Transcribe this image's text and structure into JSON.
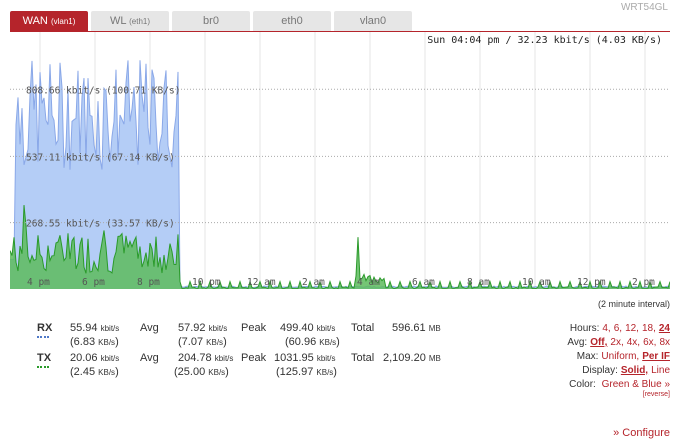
{
  "device_name": "WRT54GL",
  "tabs": [
    {
      "label": "WAN",
      "sub": "(vlan1)",
      "active": true
    },
    {
      "label": "WL",
      "sub": "(eth1)",
      "active": false
    },
    {
      "label": "br0",
      "sub": "",
      "active": false
    },
    {
      "label": "eth0",
      "sub": "",
      "active": false
    },
    {
      "label": "vlan0",
      "sub": "",
      "active": false
    }
  ],
  "graph": {
    "status": "Sun 04:04 pm / 32.23 kbit/s (4.03 KB/s)",
    "gridlines": [
      {
        "label": "808.66 kbit/s (100.71 KB/s)",
        "value": 808.66
      },
      {
        "label": "537.11 kbit/s (67.14 KB/s)",
        "value": 537.11
      },
      {
        "label": "268.55 kbit/s (33.57 KB/s)",
        "value": 268.55
      }
    ],
    "time_labels": [
      "4 pm",
      "6 pm",
      "8 pm",
      "10 pm",
      "12 am",
      "2 am",
      "4 am",
      "6 am",
      "8 am",
      "10 am",
      "12 pm",
      "2 pm"
    ],
    "colors": {
      "rx": "#8aa8e8",
      "rx_fill": "#b4cdf6",
      "tx": "#2a9a2a",
      "tx_fill": "#5dbb5d",
      "grid": "#cccccc"
    }
  },
  "interval_note": "(2 minute interval)",
  "stats": {
    "rx": {
      "label": "RX",
      "cur": "55.94",
      "cur_unit": "kbit/s",
      "cur_kb": "6.83",
      "avg": "57.92",
      "avg_kb": "7.07",
      "peak": "499.40",
      "peak_kb": "60.96",
      "total": "596.61"
    },
    "tx": {
      "label": "TX",
      "cur": "20.06",
      "cur_unit": "kbit/s",
      "cur_kb": "2.45",
      "avg": "204.78",
      "avg_kb": "25.00",
      "peak": "1031.95",
      "peak_kb": "125.97",
      "total": "2,109.20"
    },
    "labels": {
      "avg": "Avg",
      "peak": "Peak",
      "total": "Total",
      "kbits": "kbit/s",
      "kbs": "KB/s",
      "mb": "MB"
    }
  },
  "controls": {
    "hours_label": "Hours:",
    "hours": [
      "4",
      "6",
      "12",
      "18",
      "24"
    ],
    "hours_selected": "24",
    "avg_label": "Avg:",
    "avg": [
      "Off",
      "2x",
      "4x",
      "6x",
      "8x"
    ],
    "avg_selected": "Off",
    "max_label": "Max:",
    "max": [
      "Uniform",
      "Per IF"
    ],
    "max_selected": "Per IF",
    "display_label": "Display:",
    "display": [
      "Solid",
      "Line"
    ],
    "display_selected": "Solid",
    "color_label": "Color:",
    "color_value": "Green & Blue »",
    "reverse": "[reverse]"
  },
  "configure_link": "» Configure"
}
